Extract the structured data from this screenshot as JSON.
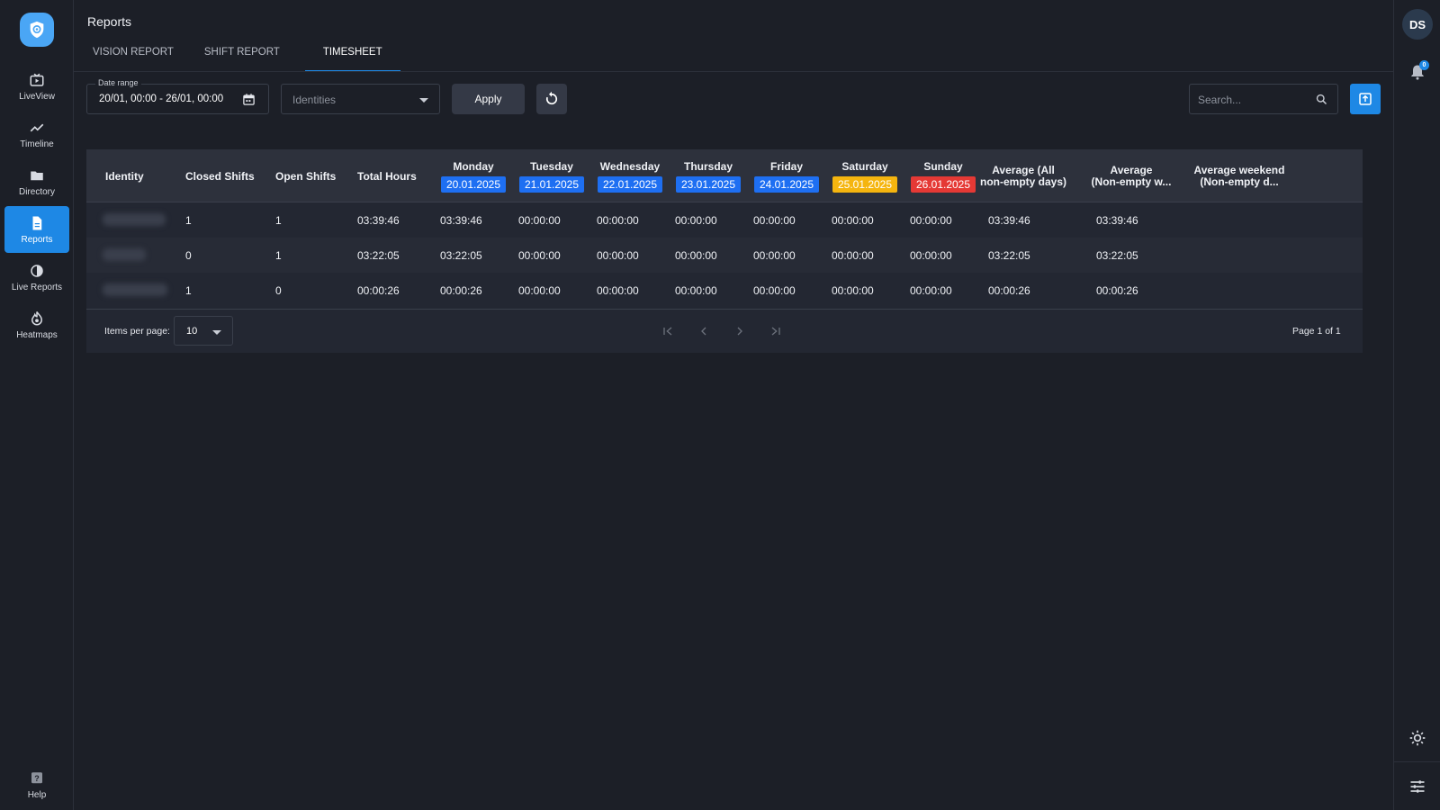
{
  "sidebar": {
    "items": [
      {
        "label": "LiveView",
        "icon": "tv-icon"
      },
      {
        "label": "Timeline",
        "icon": "trend-icon"
      },
      {
        "label": "Directory",
        "icon": "folder-icon"
      },
      {
        "label": "Reports",
        "icon": "document-icon",
        "active": true
      },
      {
        "label": "Live Reports",
        "icon": "live-reports-icon"
      },
      {
        "label": "Heatmaps",
        "icon": "fire-icon"
      }
    ],
    "help_label": "Help"
  },
  "header": {
    "title": "Reports",
    "tabs": [
      {
        "label": "VISION REPORT"
      },
      {
        "label": "SHIFT REPORT"
      },
      {
        "label": "TIMESHEET",
        "active": true
      }
    ]
  },
  "user": {
    "initials": "DS",
    "notifications": "0"
  },
  "filters": {
    "date_range_label": "Date range",
    "date_range_value": "20/01, 00:00 - 26/01, 00:00",
    "identities_placeholder": "Identities",
    "apply_label": "Apply",
    "search_placeholder": "Search..."
  },
  "table": {
    "columns": {
      "identity": "Identity",
      "closed_shifts": "Closed Shifts",
      "open_shifts": "Open Shifts",
      "total_hours": "Total Hours",
      "avg_all_1": "Average (All",
      "avg_all_2": "non-empty days)",
      "avg_week_1": "Average",
      "avg_week_2": "(Non-empty w...",
      "avg_weekend_1": "Average weekend",
      "avg_weekend_2": "(Non-empty d..."
    },
    "days": [
      {
        "name": "Monday",
        "date": "20.01.2025",
        "color": "#1e6ff2"
      },
      {
        "name": "Tuesday",
        "date": "21.01.2025",
        "color": "#1e6ff2"
      },
      {
        "name": "Wednesday",
        "date": "22.01.2025",
        "color": "#1e6ff2"
      },
      {
        "name": "Thursday",
        "date": "23.01.2025",
        "color": "#1e6ff2"
      },
      {
        "name": "Friday",
        "date": "24.01.2025",
        "color": "#1e6ff2"
      },
      {
        "name": "Saturday",
        "date": "25.01.2025",
        "color": "#f5b50f"
      },
      {
        "name": "Sunday",
        "date": "26.01.2025",
        "color": "#e53935"
      }
    ],
    "rows": [
      {
        "closed": "1",
        "open": "1",
        "total": "03:39:46",
        "days": [
          "03:39:46",
          "00:00:00",
          "00:00:00",
          "00:00:00",
          "00:00:00",
          "00:00:00",
          "00:00:00"
        ],
        "avg_all": "03:39:46",
        "avg_week": "03:39:46",
        "avg_weekend": ""
      },
      {
        "closed": "0",
        "open": "1",
        "total": "03:22:05",
        "days": [
          "03:22:05",
          "00:00:00",
          "00:00:00",
          "00:00:00",
          "00:00:00",
          "00:00:00",
          "00:00:00"
        ],
        "avg_all": "03:22:05",
        "avg_week": "03:22:05",
        "avg_weekend": ""
      },
      {
        "closed": "1",
        "open": "0",
        "total": "00:00:26",
        "days": [
          "00:00:26",
          "00:00:00",
          "00:00:00",
          "00:00:00",
          "00:00:00",
          "00:00:00",
          "00:00:00"
        ],
        "avg_all": "00:00:26",
        "avg_week": "00:00:26",
        "avg_weekend": ""
      }
    ]
  },
  "pagination": {
    "items_per_page_label": "Items per page:",
    "items_per_page_value": "10",
    "page_info": "Page 1 of 1"
  }
}
